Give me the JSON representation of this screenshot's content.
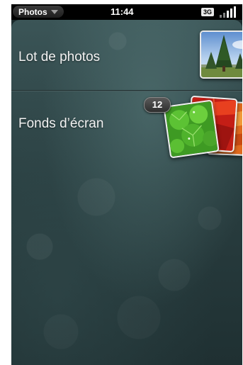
{
  "status_bar": {
    "app_menu_label": "Photos",
    "menu_icon": "triangle-down-icon",
    "time": "11:44",
    "network_badge": "3G",
    "signal_icon": "signal-bars-icon"
  },
  "albums": [
    {
      "label": "Lot de photos",
      "thumbnail_icon": "tree-landscape-photo"
    },
    {
      "label": "Fonds d’écran",
      "count": "12",
      "thumbnail_icon": "leaf-photo-stack"
    }
  ],
  "colors": {
    "background": "#2a3f41",
    "status_bar": "#000000",
    "text": "#f2f2f2"
  }
}
